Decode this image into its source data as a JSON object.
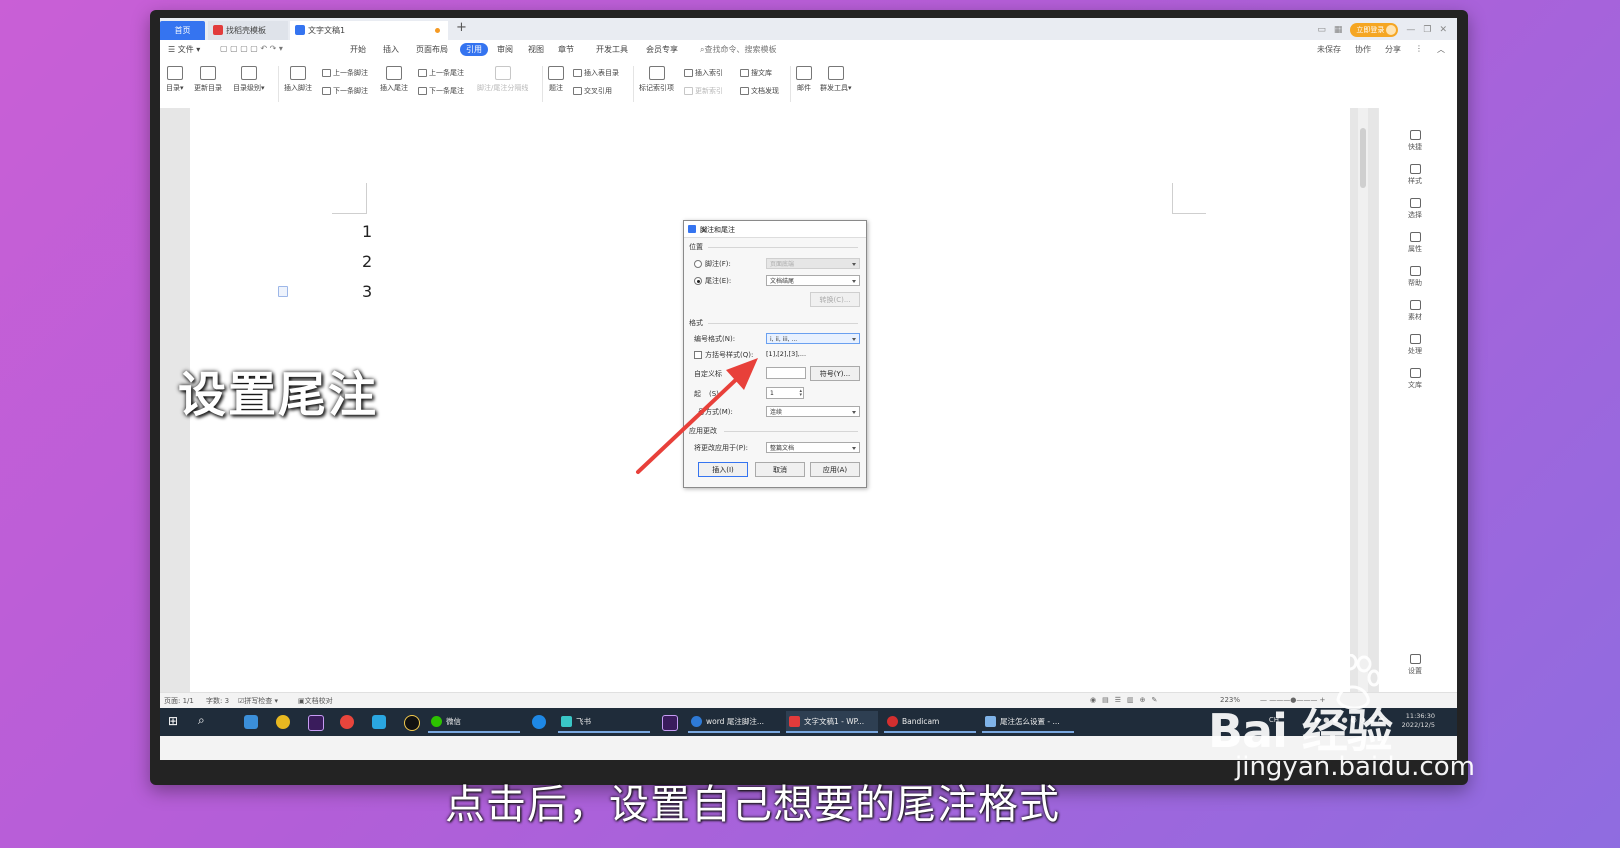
{
  "tabs": {
    "home": "首页",
    "template": "找稻壳模板",
    "doc": "文字文稿1",
    "add": "+"
  },
  "titlebar": {
    "login": "立即登录"
  },
  "menu": {
    "file": "☰ 文件 ▾",
    "items": [
      "开始",
      "插入",
      "页面布局",
      "引用",
      "审阅",
      "视图",
      "章节",
      "开发工具",
      "会员专享"
    ],
    "active_index": 3,
    "search": "查找命令、搜索模板",
    "right": [
      "未保存",
      "协作",
      "分享"
    ]
  },
  "ribbon": {
    "toc": "目录",
    "update_toc": "更新目录",
    "toc_level": "目录级别",
    "insert_footnote": "插入脚注",
    "prev_footnote": "上一条脚注",
    "next_footnote": "下一条脚注",
    "insert_endnote": "插入尾注",
    "prev_endnote": "上一条尾注",
    "next_endnote": "下一条尾注",
    "separator": "脚注/尾注分隔线",
    "caption": "题注",
    "insert_table_toc": "插入表目录",
    "cross_ref": "交叉引用",
    "mark_index": "标记索引项",
    "insert_index": "插入索引",
    "update_index": "更新索引",
    "doc_lib": "搜文库",
    "doc_find": "文档发现",
    "mail": "邮件",
    "mass_tool": "群发工具"
  },
  "document": {
    "lines": [
      "1",
      "2",
      "3"
    ],
    "overlay_title": "设置尾注"
  },
  "dialog": {
    "title": "脚注和尾注",
    "close": "×",
    "position_label": "位置",
    "footnote_label": "脚注(F):",
    "footnote_value": "页面底端",
    "endnote_label": "尾注(E):",
    "endnote_value": "文档结尾",
    "convert_btn": "转换(C)...",
    "format_label": "格式",
    "numfmt_label": "编号格式(N):",
    "numfmt_value": "i, ii, iii, ...",
    "bracket_label": "方括号样式(Q):",
    "bracket_value": "[1],[2],[3],...",
    "custom_label": "自定义标",
    "symbol_btn": "符号(Y)...",
    "start_label": "起",
    "start_suffix": "(S):",
    "start_value": "1",
    "numbering_label": "号方式(M):",
    "numbering_value": "连续",
    "apply_section": "应用更改",
    "apply_to_label": "将更改应用于(P):",
    "apply_to_value": "整篇文档",
    "insert_btn": "插入(I)",
    "cancel_btn": "取消",
    "apply_btn": "应用(A)"
  },
  "sidebar": [
    "快捷",
    "样式",
    "选择",
    "属性",
    "帮助",
    "素材",
    "处理",
    "文库",
    "设置"
  ],
  "status": {
    "page": "页面: 1/1",
    "words": "字数: 3",
    "spell": "拼写检查 ▾",
    "proof": "文档校对",
    "zoom": "223%"
  },
  "taskbar": {
    "apps": [
      "微信",
      "飞书",
      "word 尾注脚注...",
      "文字文稿1 - WP...",
      "Bandicam",
      "尾注怎么设置 - ..."
    ],
    "tray": "CH",
    "time": "11:36:30",
    "date": "2022/12/5"
  },
  "caption": "点击后，设置自己想要的尾注格式",
  "watermark": {
    "brand": "Bai 经验",
    "url": "jingyan.baidu.com"
  },
  "colors": {
    "accent": "#3574f0",
    "arrow": "#e8403a",
    "login": "#f5a623"
  }
}
